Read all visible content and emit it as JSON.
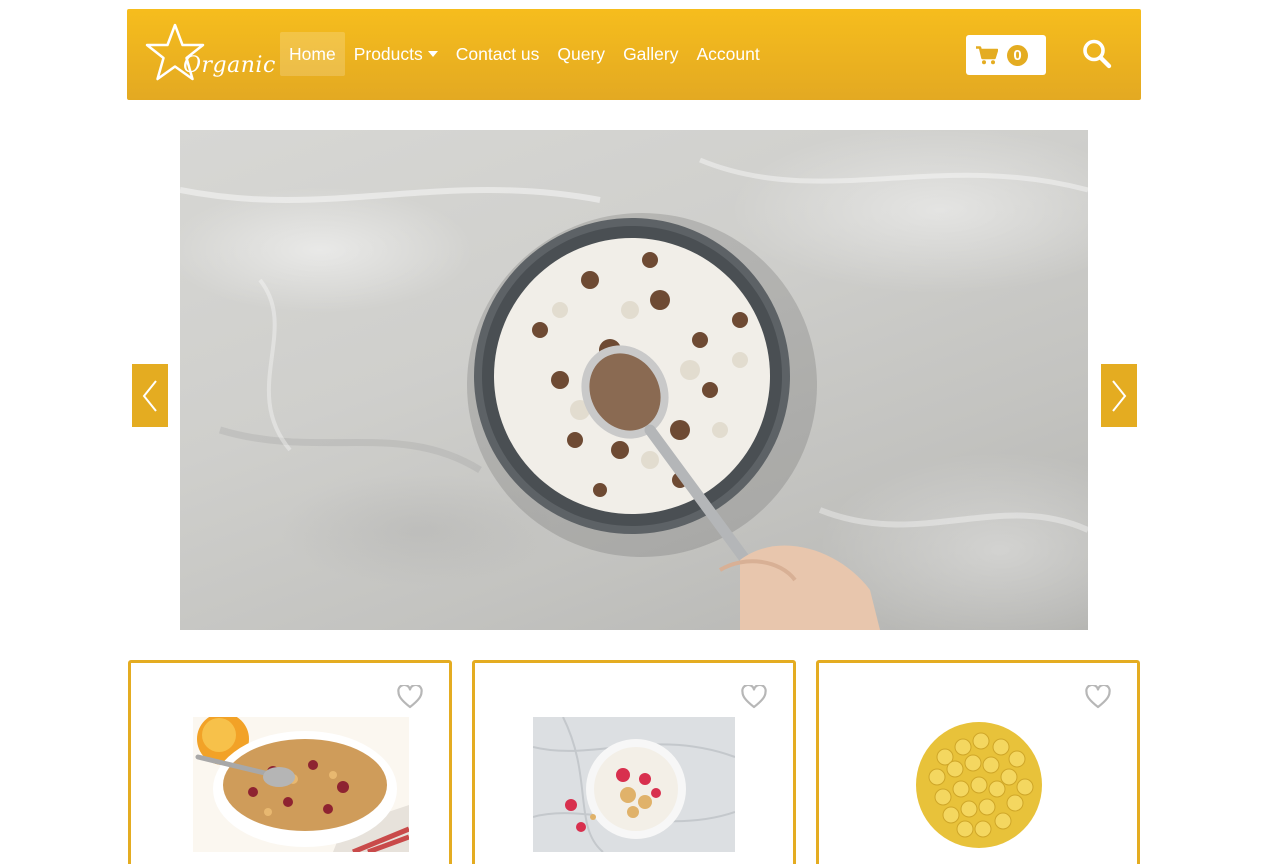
{
  "brand": {
    "name": "Organic",
    "logo_icon": "star-logo-icon"
  },
  "nav": {
    "items": [
      {
        "label": "Home",
        "active": true
      },
      {
        "label": "Products",
        "dropdown": true
      },
      {
        "label": "Contact us"
      },
      {
        "label": "Query"
      },
      {
        "label": "Gallery"
      },
      {
        "label": "Account"
      }
    ]
  },
  "cart": {
    "icon": "shopping-cart-icon",
    "count": "0"
  },
  "search": {
    "icon": "search-icon"
  },
  "carousel": {
    "slide_count": 6,
    "active_index": 2,
    "prev_icon": "chevron-left-icon",
    "next_icon": "chevron-right-icon"
  },
  "products": [
    {
      "image": "granola-bowl",
      "wishlist_icon": "heart-outline-icon"
    },
    {
      "image": "yogurt-cereal-bowl",
      "wishlist_icon": "heart-outline-icon"
    },
    {
      "image": "yellow-split-peas",
      "wishlist_icon": "heart-outline-icon"
    }
  ],
  "colors": {
    "accent": "#e4ac21",
    "navbar_top": "#f6bd1d",
    "text_on_accent": "#ffffff"
  }
}
